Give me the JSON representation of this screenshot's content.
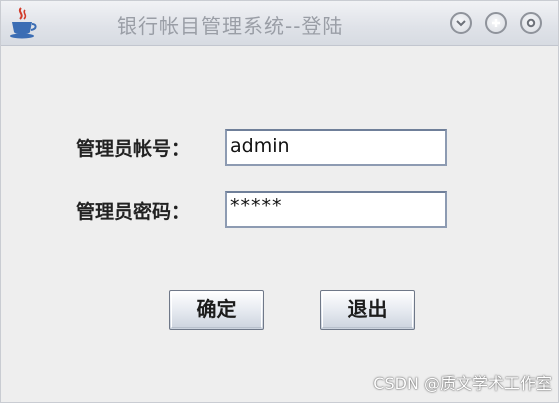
{
  "window": {
    "title": "银行帐目管理系统--登陆",
    "app_icon": "java-coffee-cup-icon",
    "controls": [
      "minimize-icon",
      "maximize-icon",
      "close-icon"
    ]
  },
  "form": {
    "account_label": "管理员帐号：",
    "account_value": "admin",
    "password_label": "管理员密码：",
    "password_value": "*****"
  },
  "buttons": {
    "ok_label": "确定",
    "exit_label": "退出"
  },
  "watermark": "CSDN @质文学术工作室",
  "colors": {
    "title_text": "#9a9ea6",
    "field_border": "#8d9bb2",
    "background": "#eeeeee"
  }
}
